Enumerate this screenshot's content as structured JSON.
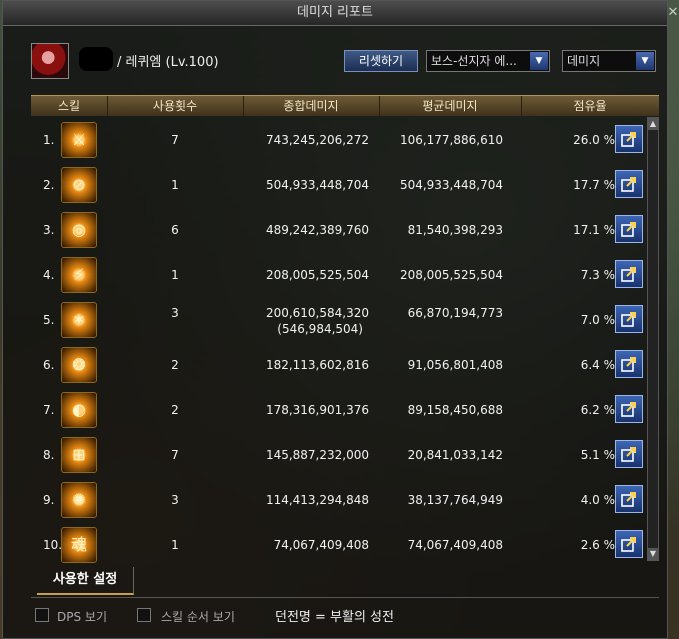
{
  "window": {
    "title": "데미지 리포트",
    "close": "✕"
  },
  "character": {
    "name": "/ 레퀴엠 (Lv.100)"
  },
  "controls": {
    "reset_label": "리셋하기",
    "boss_select": "보스-선지자 에...",
    "metric_select": "데미지"
  },
  "table": {
    "headers": [
      "스킬",
      "사용횟수",
      "종합데미지",
      "평균데미지",
      "점유율"
    ],
    "rows": [
      {
        "rank": "1.",
        "uses": "7",
        "total": "743,245,206,272",
        "avg": "106,177,886,610",
        "share": "26.0 %",
        "icon": "skill-icon-1"
      },
      {
        "rank": "2.",
        "uses": "1",
        "total": "504,933,448,704",
        "avg": "504,933,448,704",
        "share": "17.7 %",
        "icon": "skill-icon-2"
      },
      {
        "rank": "3.",
        "uses": "6",
        "total": "489,242,389,760",
        "avg": "81,540,398,293",
        "share": "17.1 %",
        "icon": "skill-icon-3"
      },
      {
        "rank": "4.",
        "uses": "1",
        "total": "208,005,525,504",
        "avg": "208,005,525,504",
        "share": "7.3 %",
        "icon": "skill-icon-4"
      },
      {
        "rank": "5.",
        "uses": "3",
        "total": "200,610,584,320",
        "sub": "(546,984,504)",
        "avg": "66,870,194,773",
        "share": "7.0 %",
        "icon": "skill-icon-5"
      },
      {
        "rank": "6.",
        "uses": "2",
        "total": "182,113,602,816",
        "avg": "91,056,801,408",
        "share": "6.4 %",
        "icon": "skill-icon-6"
      },
      {
        "rank": "7.",
        "uses": "2",
        "total": "178,316,901,376",
        "avg": "89,158,450,688",
        "share": "6.2 %",
        "icon": "skill-icon-7"
      },
      {
        "rank": "8.",
        "uses": "7",
        "total": "145,887,232,000",
        "avg": "20,841,033,142",
        "share": "5.1 %",
        "icon": "skill-icon-8"
      },
      {
        "rank": "9.",
        "uses": "3",
        "total": "114,413,294,848",
        "avg": "38,137,764,949",
        "share": "4.0 %",
        "icon": "skill-icon-9"
      },
      {
        "rank": "10.",
        "uses": "1",
        "total": "74,067,409,408",
        "avg": "74,067,409,408",
        "share": "2.6 %",
        "icon": "skill-icon-10"
      }
    ]
  },
  "footer": {
    "tab_label": "사용한 설정",
    "dps_label": "DPS 보기",
    "order_label": "스킬 순서 보기",
    "dungeon_label": "던전명 = 부활의 성전"
  }
}
